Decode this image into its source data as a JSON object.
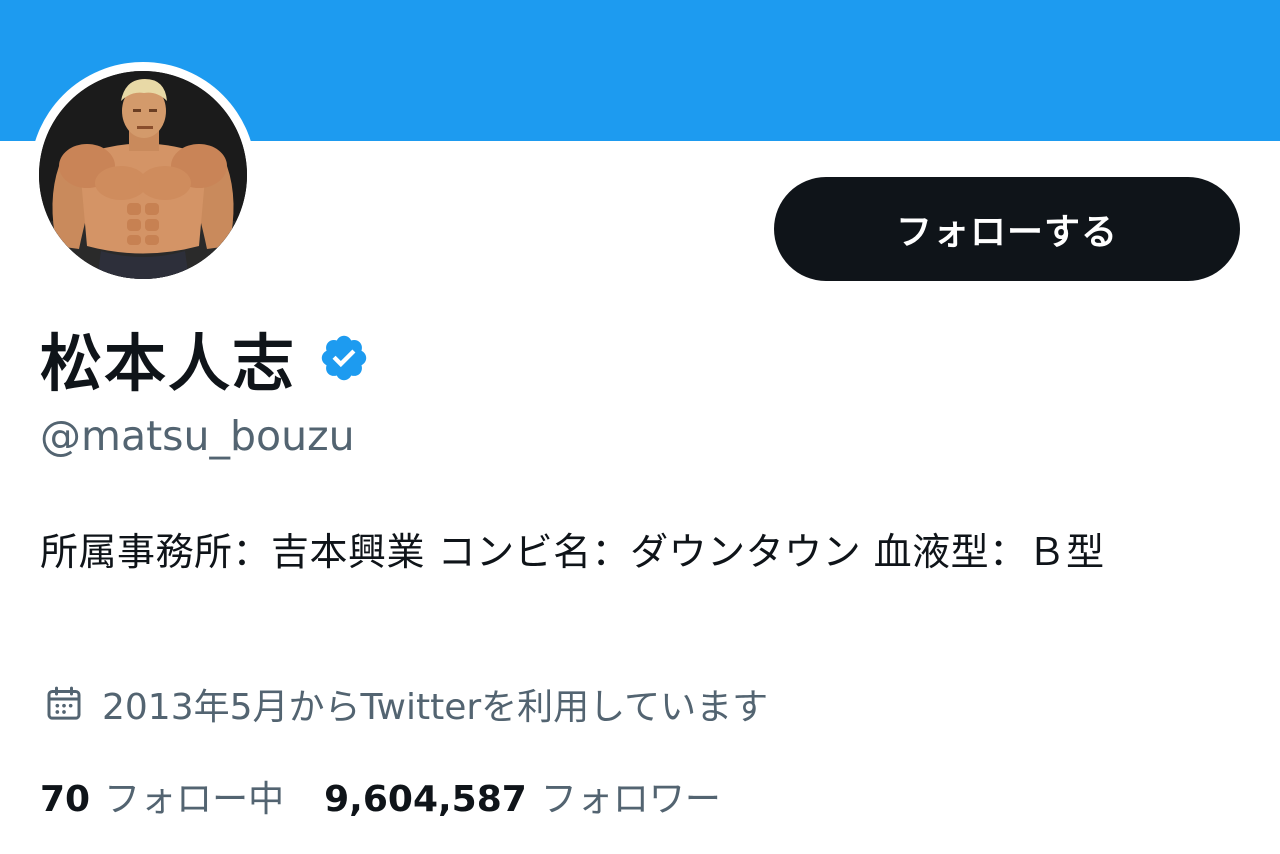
{
  "colors": {
    "banner": "#1d9bf0",
    "button_bg": "#0f1419",
    "button_text": "#ffffff",
    "verified": "#1d9bf0",
    "secondary_text": "#536471",
    "primary_text": "#0f1419"
  },
  "header": {
    "banner_icon": "profile-banner",
    "avatar_icon": "profile-avatar"
  },
  "actions": {
    "follow_label": "フォローする"
  },
  "profile": {
    "display_name": "松本人志",
    "verified_icon": "verified-badge-icon",
    "handle": "@matsu_bouzu",
    "bio": "所属事務所：吉本興業 コンビ名：ダウンタウン 血液型：Ｂ型",
    "calendar_icon": "calendar-icon",
    "joined": "2013年5月からTwitterを利用しています"
  },
  "stats": {
    "following_count": "70",
    "following_label": "フォロー中",
    "followers_count": "9,604,587",
    "followers_label": "フォロワー"
  }
}
